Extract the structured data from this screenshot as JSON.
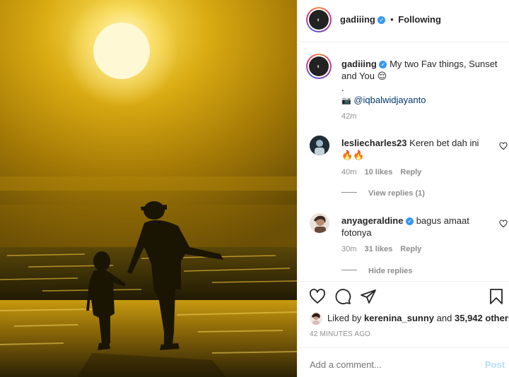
{
  "header": {
    "username": "gadiiing",
    "follow_status": "Following",
    "dot": "•"
  },
  "caption": {
    "username": "gadiiing",
    "text_line1": "My two Fav things, Sunset",
    "text_line2": "and You",
    "emoji": "😌",
    "dot": ".",
    "camera_emoji": "📷",
    "mention": "@iqbalwidjayanto",
    "time": "42m"
  },
  "comments": [
    {
      "username": "lesliecharles23",
      "text": "Keren bet dah ini",
      "emoji": "🔥🔥",
      "time": "40m",
      "likes": "10 likes",
      "reply": "Reply",
      "replies_toggle": "View replies (1)"
    },
    {
      "username": "anyageraldine",
      "text_line1": "bagus amaat",
      "text_line2": "fotonya",
      "time": "30m",
      "likes": "31 likes",
      "reply": "Reply",
      "replies_toggle": "Hide replies"
    }
  ],
  "likes": {
    "prefix": "Liked by",
    "user": "kerenina_sunny",
    "and": "and",
    "others": "35,942 others"
  },
  "timestamp": "42 MINUTES AGO",
  "comment_box": {
    "placeholder": "Add a comment...",
    "post_label": "Post"
  },
  "colors": {
    "accent": "#3897f0",
    "sky_top": "#4a3a08",
    "sun": "#fff7c0",
    "sea": "#2a2408"
  }
}
